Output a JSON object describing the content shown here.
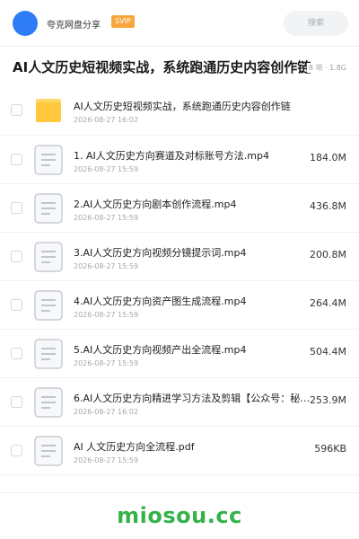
{
  "header": {
    "share_name": "夸克网盘分享",
    "badge": "SVIP",
    "search_placeholder": "搜索"
  },
  "folder": {
    "title": "AI人文历史短视频实战，系统跑通历史内容创作链",
    "meta": "8 项 · 1.8G"
  },
  "files": [
    {
      "name": "AI人文历史短视频实战，系统跑通历史内容创作链",
      "date": "2026-08-27 16:02",
      "size": "",
      "icon": "folder-icon"
    },
    {
      "name": "1. AI人文历史方向赛道及对标账号方法.mp4",
      "date": "2026-08-27 15:59",
      "size": "184.0M",
      "icon": "document-icon"
    },
    {
      "name": "2.AI人文历史方向剧本创作流程.mp4",
      "date": "2026-08-27 15:59",
      "size": "436.8M",
      "icon": "document-icon"
    },
    {
      "name": "3.AI人文历史方向视频分镜提示词.mp4",
      "date": "2026-08-27 15:59",
      "size": "200.8M",
      "icon": "document-icon"
    },
    {
      "name": "4.AI人文历史方向资产图生成流程.mp4",
      "date": "2026-08-27 15:59",
      "size": "264.4M",
      "icon": "document-icon"
    },
    {
      "name": "5.AI人文历史方向视频产出全流程.mp4",
      "date": "2026-08-27 15:59",
      "size": "504.4M",
      "icon": "document-icon"
    },
    {
      "name": "6.AI人文历史方向精进学习方法及剪辑【公众号：秘…",
      "date": "2026-08-27 16:02",
      "size": "253.9M",
      "icon": "document-icon"
    },
    {
      "name": "AI 人文历史方向全流程.pdf",
      "date": "2026-08-27 15:59",
      "size": "596KB",
      "icon": "document-icon"
    }
  ],
  "watermark": "miosou.cc",
  "colors": {
    "avatar": "#2e7cf6",
    "svip": "#f7a53c",
    "folder": "#ffc83d",
    "watermark": "#35b24a"
  }
}
